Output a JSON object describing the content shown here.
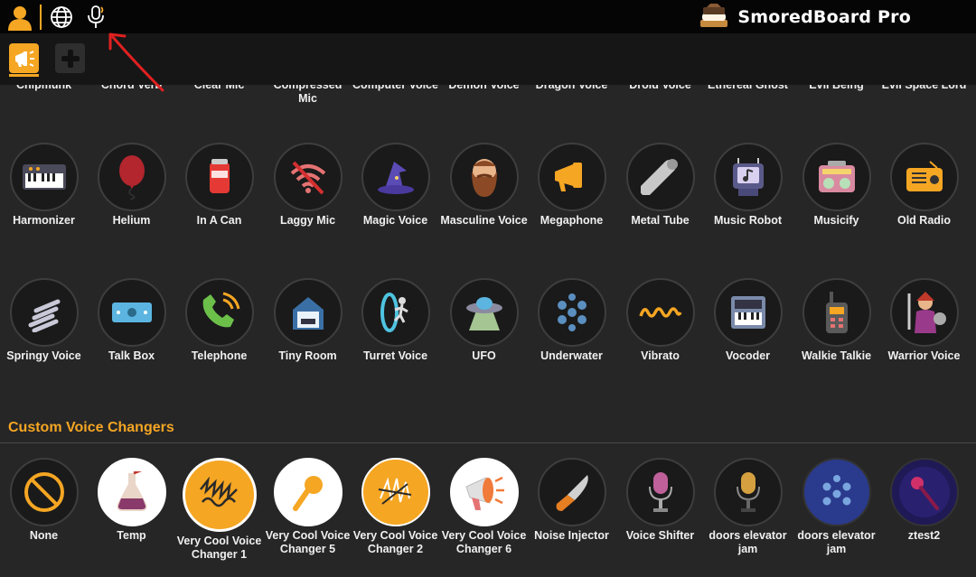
{
  "app": {
    "title": "SmoredBoard Pro"
  },
  "topbar": {
    "icons": [
      "user-icon",
      "globe-icon",
      "microphone-icon"
    ]
  },
  "toolbar": {
    "tabs": [
      "megaphone-tab",
      "add-tab"
    ]
  },
  "cut_row": [
    "Chipmunk",
    "Chord Verb",
    "Clear Mic",
    "Compressed Mic",
    "Computer Voice",
    "Demon Voice",
    "Dragon Voice",
    "Droid Voice",
    "Ethereal Ghost",
    "Evil Being",
    "Evil Space Lord"
  ],
  "rows": [
    [
      {
        "label": "Harmonizer",
        "icon": "keyboard-icon"
      },
      {
        "label": "Helium",
        "icon": "balloon-icon"
      },
      {
        "label": "In A Can",
        "icon": "soda-can-icon"
      },
      {
        "label": "Laggy Mic",
        "icon": "no-wifi-icon"
      },
      {
        "label": "Magic Voice",
        "icon": "wizard-hat-icon"
      },
      {
        "label": "Masculine Voice",
        "icon": "beard-icon"
      },
      {
        "label": "Megaphone",
        "icon": "megaphone-icon"
      },
      {
        "label": "Metal Tube",
        "icon": "pipe-icon"
      },
      {
        "label": "Music Robot",
        "icon": "robot-icon"
      },
      {
        "label": "Musicify",
        "icon": "boombox-icon"
      },
      {
        "label": "Old Radio",
        "icon": "radio-icon"
      }
    ],
    [
      {
        "label": "Springy Voice",
        "icon": "spring-icon"
      },
      {
        "label": "Talk Box",
        "icon": "talk-box-icon"
      },
      {
        "label": "Telephone",
        "icon": "telephone-icon"
      },
      {
        "label": "Tiny Room",
        "icon": "tiny-room-icon"
      },
      {
        "label": "Turret Voice",
        "icon": "portal-icon"
      },
      {
        "label": "UFO",
        "icon": "ufo-icon"
      },
      {
        "label": "Underwater",
        "icon": "bubbles-icon"
      },
      {
        "label": "Vibrato",
        "icon": "wave-icon"
      },
      {
        "label": "Vocoder",
        "icon": "synth-icon"
      },
      {
        "label": "Walkie Talkie",
        "icon": "walkie-talkie-icon"
      },
      {
        "label": "Warrior Voice",
        "icon": "warrior-icon"
      }
    ]
  ],
  "custom_section": {
    "title": "Custom Voice Changers",
    "items": [
      {
        "label": "None",
        "icon": "none-icon"
      },
      {
        "label": "Temp",
        "icon": "potion-icon"
      },
      {
        "label": "Very Cool Voice Changer 1",
        "icon": "scribble-icon"
      },
      {
        "label": "Very Cool Voice Changer 5",
        "icon": "microphone-icon"
      },
      {
        "label": "Very Cool Voice Changer 2",
        "icon": "scribble-icon"
      },
      {
        "label": "Very Cool Voice Changer 6",
        "icon": "megaphone-icon"
      },
      {
        "label": "Noise Injector",
        "icon": "knife-icon"
      },
      {
        "label": "Voice Shifter",
        "icon": "studio-mic-icon"
      },
      {
        "label": "doors elevator jam",
        "icon": "studio-mic-icon"
      },
      {
        "label": "doors elevator jam",
        "icon": "bubbles-icon"
      },
      {
        "label": "ztest2",
        "icon": "stage-mic-icon"
      }
    ]
  },
  "colors": {
    "accent": "#f5a623",
    "background": "#262626",
    "topbar": "#050505"
  }
}
